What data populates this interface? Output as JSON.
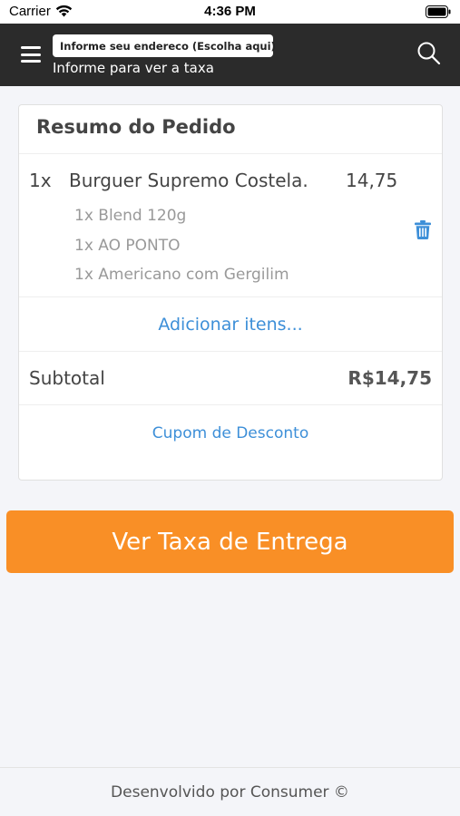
{
  "status_bar": {
    "carrier": "Carrier",
    "time": "4:36 PM"
  },
  "header": {
    "address_select": "Informe seu endereco (Escolha aqui)",
    "address_hint": "Informe para ver a taxa",
    "background_color": "#2b2b2b",
    "icons": [
      "menu-icon",
      "chevron-down-icon",
      "search-icon"
    ]
  },
  "order_summary": {
    "title": "Resumo do Pedido",
    "items": [
      {
        "qty": "1x",
        "name": "Burguer Supremo Costela.",
        "price": "14,75",
        "options": [
          "1x Blend 120g",
          "1x AO PONTO",
          "1x Americano com Gergilim"
        ]
      }
    ],
    "add_items_label": "Adicionar itens...",
    "subtotal_label": "Subtotal",
    "subtotal_value": "R$14,75",
    "coupon_label": "Cupom de Desconto"
  },
  "actions": {
    "delivery_fee_button": "Ver Taxa de Entrega",
    "accent_color": "#f98f26",
    "link_color": "#3d8fd8"
  },
  "footer": {
    "text": "Desenvolvido por Consumer ©"
  }
}
